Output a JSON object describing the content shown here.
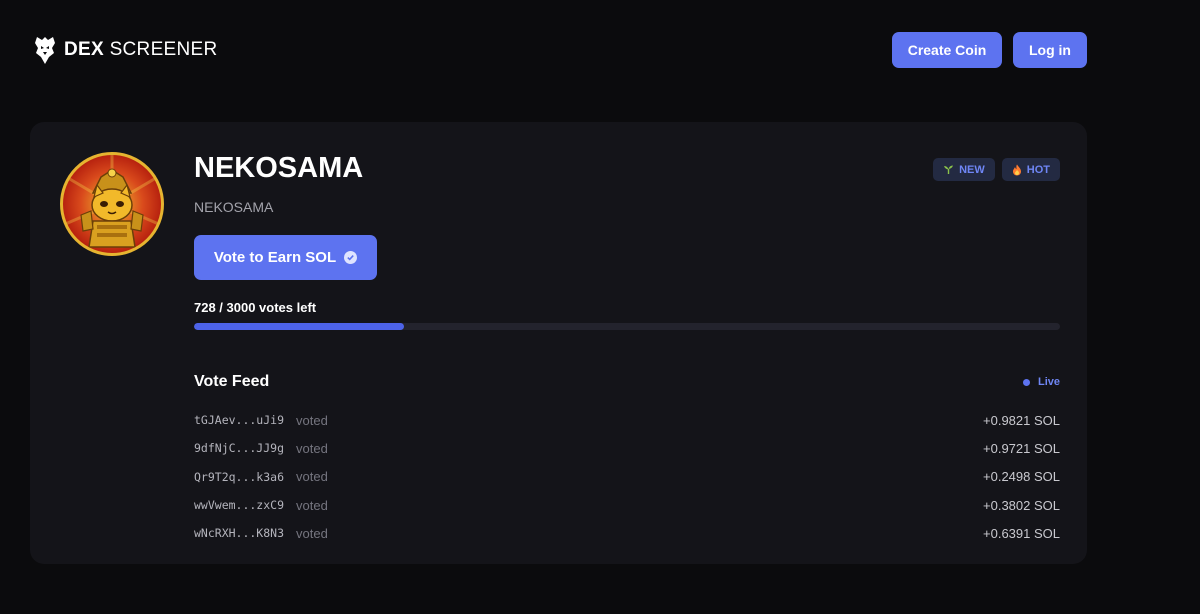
{
  "header": {
    "logo_bold": "DEX",
    "logo_light": "SCREENER",
    "create_coin_label": "Create Coin",
    "login_label": "Log in"
  },
  "coin": {
    "name": "NEKOSAMA",
    "subtitle": "NEKOSAMA",
    "badges": [
      {
        "icon": "sprout-icon",
        "label": "NEW"
      },
      {
        "icon": "fire-icon",
        "label": "HOT"
      }
    ],
    "vote_button_label": "Vote to Earn SOL",
    "votes_left_text": "728 / 3000 votes left",
    "votes_used": 728,
    "votes_total": 3000
  },
  "feed": {
    "title": "Vote Feed",
    "live_label": "Live",
    "rows": [
      {
        "address": "tGJAev...uJi9",
        "action": "voted",
        "amount": "+0.9821 SOL"
      },
      {
        "address": "9dfNjC...JJ9g",
        "action": "voted",
        "amount": "+0.9721 SOL"
      },
      {
        "address": "Qr9T2q...k3a6",
        "action": "voted",
        "amount": "+0.2498 SOL"
      },
      {
        "address": "wwVwem...zxC9",
        "action": "voted",
        "amount": "+0.3802 SOL"
      },
      {
        "address": "wNcRXH...K8N3",
        "action": "voted",
        "amount": "+0.6391 SOL"
      }
    ]
  },
  "colors": {
    "accent": "#5d73f0",
    "background": "#0b0b0d",
    "card": "#141419"
  }
}
